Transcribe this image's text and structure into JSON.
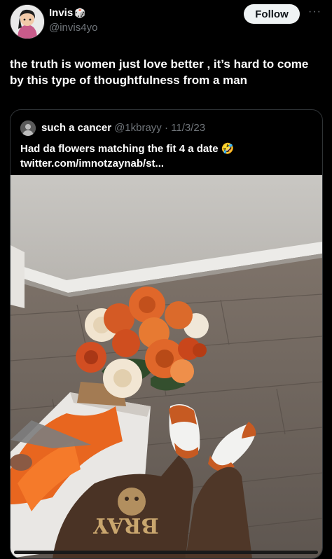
{
  "author": {
    "name": "Invis",
    "badge": "🎲",
    "handle": "@invis4yo"
  },
  "follow_label": "Follow",
  "more_label": "···",
  "tweet_text": "the truth is women just love better , it’s hard to come by this type of thoughtfulness from a man",
  "quote": {
    "name": "such a cancer",
    "handle_date": "@1kbrayy · 11/3/23",
    "text_line1": "Had da flowers matching the fit 4 a date 🤣",
    "text_line2": "twitter.com/imnotzaynab/st..."
  },
  "photo": {
    "sweatshirt_text": "BRAY"
  },
  "colors": {
    "background": "#000000",
    "text": "#e7e9ea",
    "muted": "#71767b",
    "follow_bg": "#eff3f4",
    "rose_orange": "#e2672a",
    "wood_floor": "#7b7168"
  }
}
